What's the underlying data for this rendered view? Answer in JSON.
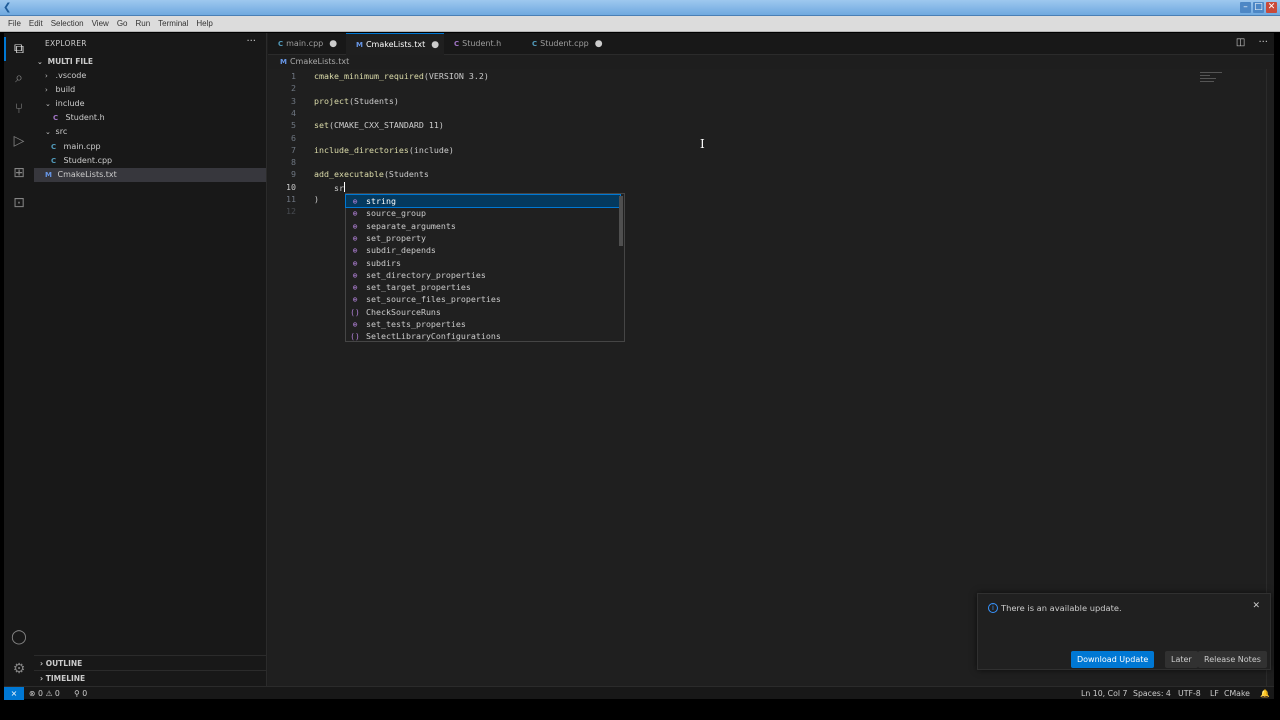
{
  "menubar": [
    "File",
    "Edit",
    "Selection",
    "View",
    "Go",
    "Run",
    "Terminal",
    "Help"
  ],
  "explorer": {
    "title": "EXPLORER",
    "more": "···",
    "root": "MULTI FILE",
    "items": [
      {
        "label": ".vscode",
        "arrow": "›"
      },
      {
        "label": "build",
        "arrow": "›"
      },
      {
        "label": "include",
        "arrow": "⌄"
      },
      {
        "label": "Student.h",
        "icon": "C"
      },
      {
        "label": "src",
        "arrow": "⌄"
      },
      {
        "label": "main.cpp",
        "icon": "C"
      },
      {
        "label": "Student.cpp",
        "icon": "C"
      },
      {
        "label": "CmakeLists.txt",
        "icon": "M"
      }
    ],
    "outline": "OUTLINE",
    "timeline": "TIMELINE"
  },
  "tabs": [
    {
      "label": "main.cpp",
      "icon": "C",
      "modified": "●"
    },
    {
      "label": "CmakeLists.txt",
      "icon": "M",
      "modified": "●"
    },
    {
      "label": "Student.h",
      "icon": "C",
      "modified": ""
    },
    {
      "label": "Student.cpp",
      "icon": "C",
      "modified": "●"
    }
  ],
  "breadcrumb": {
    "icon": "M",
    "label": "CmakeLists.txt"
  },
  "editor": {
    "line_numbers": [
      "1",
      "2",
      "3",
      "4",
      "5",
      "6",
      "7",
      "8",
      "9",
      "10",
      "11",
      "12"
    ],
    "lines": [
      {
        "fn": "cmake_minimum_required",
        "rest": "(VERSION 3.2)"
      },
      {
        "fn": "",
        "rest": ""
      },
      {
        "fn": "project",
        "rest": "(Students)"
      },
      {
        "fn": "",
        "rest": ""
      },
      {
        "fn": "set",
        "rest": "(CMAKE_CXX_STANDARD 11)"
      },
      {
        "fn": "",
        "rest": ""
      },
      {
        "fn": "include_directories",
        "rest": "(include)"
      },
      {
        "fn": "",
        "rest": ""
      },
      {
        "fn": "add_executable",
        "rest": "(Students"
      },
      {
        "fn": "",
        "rest": "    sr"
      },
      {
        "fn": "",
        "rest": ")"
      },
      {
        "fn": "",
        "rest": ""
      }
    ]
  },
  "suggestions": [
    {
      "label": "string",
      "kind": "⊕"
    },
    {
      "label": "source_group",
      "kind": "⊕"
    },
    {
      "label": "separate_arguments",
      "kind": "⊕"
    },
    {
      "label": "set_property",
      "kind": "⊕"
    },
    {
      "label": "subdir_depends",
      "kind": "⊕"
    },
    {
      "label": "subdirs",
      "kind": "⊕"
    },
    {
      "label": "set_directory_properties",
      "kind": "⊕"
    },
    {
      "label": "set_target_properties",
      "kind": "⊕"
    },
    {
      "label": "set_source_files_properties",
      "kind": "⊕"
    },
    {
      "label": "CheckSourceRuns",
      "kind": "()"
    },
    {
      "label": "set_tests_properties",
      "kind": "⊕"
    },
    {
      "label": "SelectLibraryConfigurations",
      "kind": "()"
    }
  ],
  "notification": {
    "message": "There is an available update.",
    "buttons": {
      "download": "Download Update",
      "later": "Later",
      "notes": "Release Notes"
    }
  },
  "status": {
    "remote": "⨯",
    "problems": "⊗ 0 ⚠ 0",
    "ports": "⚲ 0",
    "position": "Ln 10, Col 7",
    "spaces": "Spaces: 4",
    "encoding": "UTF-8",
    "eol": "LF",
    "language": "CMake"
  }
}
